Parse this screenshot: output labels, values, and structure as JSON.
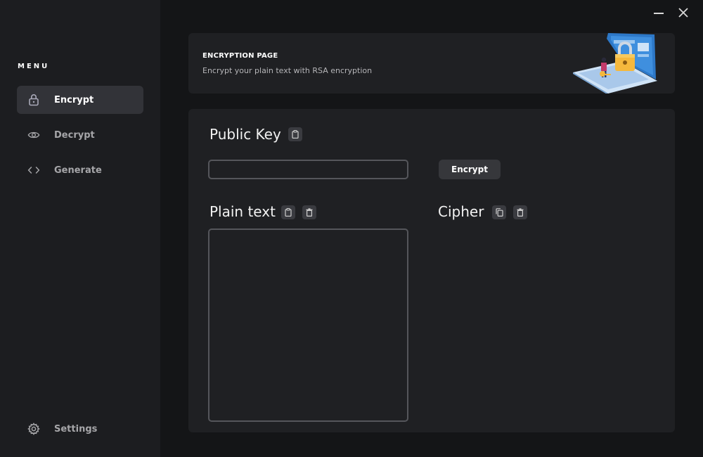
{
  "sidebar": {
    "menu_label": "MENU",
    "items": [
      {
        "label": "Encrypt",
        "icon": "lock-icon",
        "active": true
      },
      {
        "label": "Decrypt",
        "icon": "eye-icon",
        "active": false
      },
      {
        "label": "Generate",
        "icon": "code-icon",
        "active": false
      }
    ],
    "settings_label": "Settings"
  },
  "window_controls": {
    "minimize_icon": "minimize-icon",
    "close_icon": "close-icon"
  },
  "header": {
    "title": "ENCRYPTION PAGE",
    "subtitle": "Encrypt your plain text with RSA encryption",
    "illustration": "laptop-lock-illustration"
  },
  "main": {
    "public_key": {
      "title": "Public Key",
      "value": "",
      "paste_icon": "clipboard-icon"
    },
    "encrypt_button_label": "Encrypt",
    "plain_text": {
      "title": "Plain text",
      "value": "",
      "paste_icon": "clipboard-icon",
      "clear_icon": "trash-icon"
    },
    "cipher": {
      "title": "Cipher",
      "value": "",
      "copy_icon": "copy-icon",
      "clear_icon": "trash-icon"
    }
  },
  "colors": {
    "app_background": "#141517",
    "sidebar_background": "#1c1d20",
    "card_background": "#1f2023",
    "active_nav": "#323338",
    "button_background": "#36373b",
    "input_border": "#55565b"
  }
}
